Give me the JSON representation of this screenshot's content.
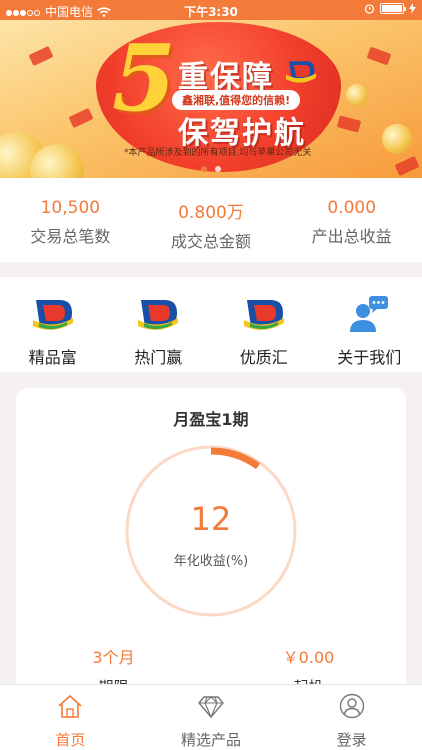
{
  "status_bar": {
    "carrier": "中国电信",
    "time": "下午3:30"
  },
  "banner": {
    "big_number": "5",
    "headline": "重保障",
    "tagline": "鑫湘联,值得您的信赖!",
    "headline2": "保驾护航",
    "disclaimer": "*本产品所涉及到的所有项目,均与苹果公司无关",
    "page_count": 3,
    "active_page": 1
  },
  "stats": [
    {
      "value": "10,500",
      "label": "交易总笔数"
    },
    {
      "value": "0.800万",
      "label": "成交总金额"
    },
    {
      "value": "0.000",
      "label": "产出总收益"
    }
  ],
  "nav_items": [
    {
      "label": "精品富",
      "icon": "brand-logo-icon"
    },
    {
      "label": "热门赢",
      "icon": "brand-logo-icon"
    },
    {
      "label": "优质汇",
      "icon": "brand-logo-icon"
    },
    {
      "label": "关于我们",
      "icon": "user-chat-icon"
    }
  ],
  "product": {
    "name": "月盈宝1期",
    "rate": "12",
    "rate_label": "年化收益(%)",
    "progress": 0.1,
    "term_value": "3个月",
    "term_label": "期限",
    "min_value": "￥0.00",
    "min_label": "起投"
  },
  "tabs": [
    {
      "label": "首页",
      "icon": "home-icon",
      "active": true
    },
    {
      "label": "精选产品",
      "icon": "diamond-icon",
      "active": false
    },
    {
      "label": "登录",
      "icon": "user-icon",
      "active": false
    }
  ],
  "colors": {
    "accent": "#f47a3a",
    "logo_blue": "#1a4fa8",
    "logo_red": "#e8392a",
    "logo_yellow": "#f5c51c",
    "logo_green": "#3aa64a"
  }
}
